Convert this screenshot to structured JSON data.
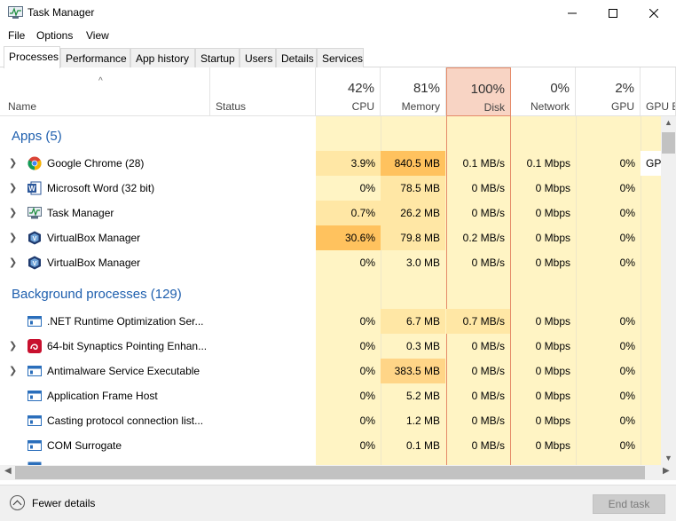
{
  "window": {
    "title": "Task Manager"
  },
  "menu": [
    "File",
    "Options",
    "View"
  ],
  "tabs": [
    "Processes",
    "Performance",
    "App history",
    "Startup",
    "Users",
    "Details",
    "Services"
  ],
  "header": {
    "name": "Name",
    "status": "Status",
    "cpu": {
      "pct": "42%",
      "label": "CPU"
    },
    "memory": {
      "pct": "81%",
      "label": "Memory"
    },
    "disk": {
      "pct": "100%",
      "label": "Disk"
    },
    "network": {
      "pct": "0%",
      "label": "Network"
    },
    "gpu": {
      "pct": "2%",
      "label": "GPU"
    },
    "gpu_engine": {
      "label": "GPU E"
    }
  },
  "apps": {
    "title": "Apps (5)",
    "rows": [
      {
        "name": "Google Chrome (28)",
        "icon": "chrome-icon",
        "cpu": "3.9%",
        "mem": "840.5 MB",
        "disk": "0.1 MB/s",
        "net": "0.1 Mbps",
        "gpu": "0%",
        "gpue": "GP"
      },
      {
        "name": "Microsoft Word (32 bit)",
        "icon": "word-icon",
        "cpu": "0%",
        "mem": "78.5 MB",
        "disk": "0 MB/s",
        "net": "0 Mbps",
        "gpu": "0%",
        "gpue": ""
      },
      {
        "name": "Task Manager",
        "icon": "task-manager-icon",
        "cpu": "0.7%",
        "mem": "26.2 MB",
        "disk": "0 MB/s",
        "net": "0 Mbps",
        "gpu": "0%",
        "gpue": ""
      },
      {
        "name": "VirtualBox Manager",
        "icon": "virtualbox-icon",
        "cpu": "30.6%",
        "mem": "79.8 MB",
        "disk": "0.2 MB/s",
        "net": "0 Mbps",
        "gpu": "0%",
        "gpue": ""
      },
      {
        "name": "VirtualBox Manager",
        "icon": "virtualbox-icon",
        "cpu": "0%",
        "mem": "3.0 MB",
        "disk": "0 MB/s",
        "net": "0 Mbps",
        "gpu": "0%",
        "gpue": ""
      }
    ]
  },
  "background": {
    "title": "Background processes (129)",
    "rows": [
      {
        "name": ".NET Runtime Optimization Ser...",
        "icon": "service-window-icon",
        "cpu": "0%",
        "mem": "6.7 MB",
        "disk": "0.7 MB/s",
        "net": "0 Mbps",
        "gpu": "0%"
      },
      {
        "name": "64-bit Synaptics Pointing Enhan...",
        "icon": "synaptics-icon",
        "cpu": "0%",
        "mem": "0.3 MB",
        "disk": "0 MB/s",
        "net": "0 Mbps",
        "gpu": "0%"
      },
      {
        "name": "Antimalware Service Executable",
        "icon": "service-window-icon",
        "cpu": "0%",
        "mem": "383.5 MB",
        "disk": "0 MB/s",
        "net": "0 Mbps",
        "gpu": "0%"
      },
      {
        "name": "Application Frame Host",
        "icon": "service-window-icon",
        "cpu": "0%",
        "mem": "5.2 MB",
        "disk": "0 MB/s",
        "net": "0 Mbps",
        "gpu": "0%"
      },
      {
        "name": "Casting protocol connection list...",
        "icon": "service-window-icon",
        "cpu": "0%",
        "mem": "1.2 MB",
        "disk": "0 MB/s",
        "net": "0 Mbps",
        "gpu": "0%"
      },
      {
        "name": "COM Surrogate",
        "icon": "service-window-icon",
        "cpu": "0%",
        "mem": "0.1 MB",
        "disk": "0 MB/s",
        "net": "0 Mbps",
        "gpu": "0%"
      }
    ]
  },
  "footer": {
    "fewer_details": "Fewer details",
    "end_task": "End task"
  }
}
